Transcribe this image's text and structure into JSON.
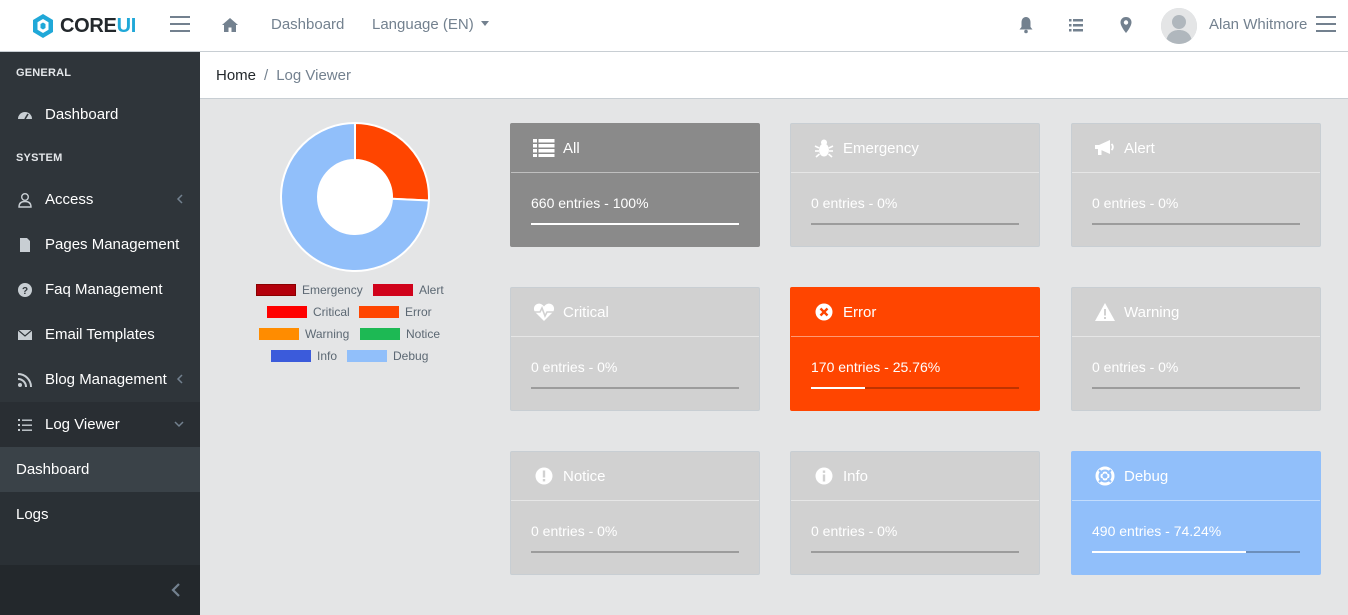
{
  "header": {
    "brand_core": "CORE",
    "brand_ui": "UI",
    "nav_dashboard": "Dashboard",
    "nav_language": "Language (EN)",
    "username": "Alan Whitmore"
  },
  "breadcrumb": {
    "home": "Home",
    "separator": "/",
    "current": "Log Viewer"
  },
  "sidebar": {
    "title_general": "GENERAL",
    "title_system": "SYSTEM",
    "items": [
      {
        "label": "Dashboard",
        "icon": "speedometer-icon"
      },
      {
        "label": "Access",
        "icon": "user-icon"
      },
      {
        "label": "Pages Management",
        "icon": "file-icon"
      },
      {
        "label": "Faq Management",
        "icon": "question-circle-icon"
      },
      {
        "label": "Email Templates",
        "icon": "envelope-icon"
      },
      {
        "label": "Blog Management",
        "icon": "rss-icon"
      },
      {
        "label": "Log Viewer",
        "icon": "list-icon"
      }
    ],
    "sub_items": [
      "Dashboard",
      "Logs"
    ]
  },
  "chart_data": {
    "type": "pie",
    "categories": [
      "Emergency",
      "Alert",
      "Critical",
      "Error",
      "Warning",
      "Notice",
      "Info",
      "Debug"
    ],
    "values": [
      0,
      0,
      0,
      170,
      0,
      0,
      0,
      490
    ],
    "colors": [
      "#b3000c",
      "#d0021b",
      "#ff0000",
      "#ff4500",
      "#ff8c00",
      "#1db954",
      "#3b5bdb",
      "#91bffa"
    ],
    "title": "",
    "xlabel": "",
    "ylabel": ""
  },
  "cards": [
    {
      "title": "All",
      "value": "660 entries - 100%",
      "percent": 100,
      "color": "#8a8a8a",
      "icon": "list-icon"
    },
    {
      "title": "Emergency",
      "value": "0 entries - 0%",
      "percent": 0,
      "color": "#d1d1d1",
      "icon": "bug-icon"
    },
    {
      "title": "Alert",
      "value": "0 entries - 0%",
      "percent": 0,
      "color": "#d1d1d1",
      "icon": "bullhorn-icon"
    },
    {
      "title": "Critical",
      "value": "0 entries - 0%",
      "percent": 0,
      "color": "#d1d1d1",
      "icon": "heartbeat-icon"
    },
    {
      "title": "Error",
      "value": "170 entries - 25.76%",
      "percent": 25.76,
      "color": "#ff4500",
      "icon": "times-circle-icon"
    },
    {
      "title": "Warning",
      "value": "0 entries - 0%",
      "percent": 0,
      "color": "#d1d1d1",
      "icon": "warning-icon"
    },
    {
      "title": "Notice",
      "value": "0 entries - 0%",
      "percent": 0,
      "color": "#d1d1d1",
      "icon": "exclamation-circle-icon"
    },
    {
      "title": "Info",
      "value": "0 entries - 0%",
      "percent": 0,
      "color": "#d1d1d1",
      "icon": "info-circle-icon"
    },
    {
      "title": "Debug",
      "value": "490 entries - 74.24%",
      "percent": 74.24,
      "color": "#91bffa",
      "icon": "life-ring-icon"
    }
  ]
}
